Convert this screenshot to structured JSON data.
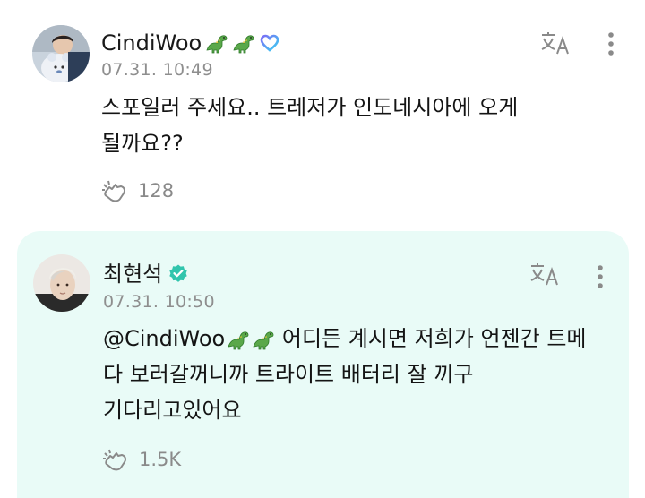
{
  "post": {
    "author": "CindiWoo",
    "author_emojis": [
      "dinosaur-icon",
      "dinosaur-icon"
    ],
    "author_badge": "heart-ring-icon",
    "timestamp": "07.31. 10:49",
    "text": "스포일러 주세요.. 트레저가 인도네시아에 오게 될까요??",
    "reaction_count": "128"
  },
  "reply": {
    "author": "최현석",
    "author_badge": "verified-check-icon",
    "timestamp": "07.31. 10:50",
    "mention": "@CindiWoo",
    "mention_emojis": [
      "dinosaur-icon",
      "dinosaur-icon"
    ],
    "text": " 어디든 계시면 저희가 언젠간 트메 다 보러갈꺼니까 트라이트 배터리 잘 끼구 기다리고있어요",
    "reaction_count": "1.5K",
    "background_color": "#e9fbf7"
  },
  "colors": {
    "verified": "#31c5ad",
    "badge_gradient_start": "#7b6cf6",
    "badge_gradient_end": "#3ad0f0",
    "dinosaur": "#4caf50"
  }
}
